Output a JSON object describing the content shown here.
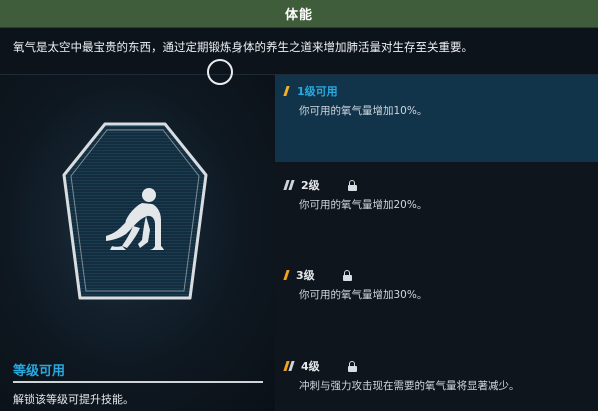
{
  "header": {
    "title": "体能"
  },
  "description": "氧气是太空中最宝贵的东西，通过定期锻炼身体的养生之道来增加肺活量对生存至关重要。",
  "skill_status": {
    "title": "等级可用",
    "subtitle": "解锁该等级可提升技能。"
  },
  "levels": [
    {
      "name": "1级可用",
      "desc": "你可用的氧气量增加10%。",
      "locked": false,
      "active": true,
      "ticks": [
        "#f3b12a",
        "#f3b12a"
      ]
    },
    {
      "name": "2级",
      "desc": "你可用的氧气量增加20%。",
      "locked": true,
      "active": false,
      "ticks": [
        "#cfd4d8",
        "#cfd4d8"
      ]
    },
    {
      "name": "3级",
      "desc": "你可用的氧气量增加30%。",
      "locked": true,
      "active": false,
      "ticks": [
        "#f3a21c",
        "#f3a21c"
      ]
    },
    {
      "name": "4级",
      "desc": "冲刺与强力攻击现在需要的氧气量将显著减少。",
      "locked": true,
      "active": false,
      "ticks": [
        "#f3a21c",
        "#cfd4d8"
      ]
    }
  ],
  "icons": {
    "badge": "fitness-runner-icon",
    "lock": "lock-icon"
  },
  "colors": {
    "header_bg": "#3f5d3a",
    "accent_blue": "#28a9e0",
    "active_row": "#12344a",
    "tick_orange": "#f3a21c"
  }
}
